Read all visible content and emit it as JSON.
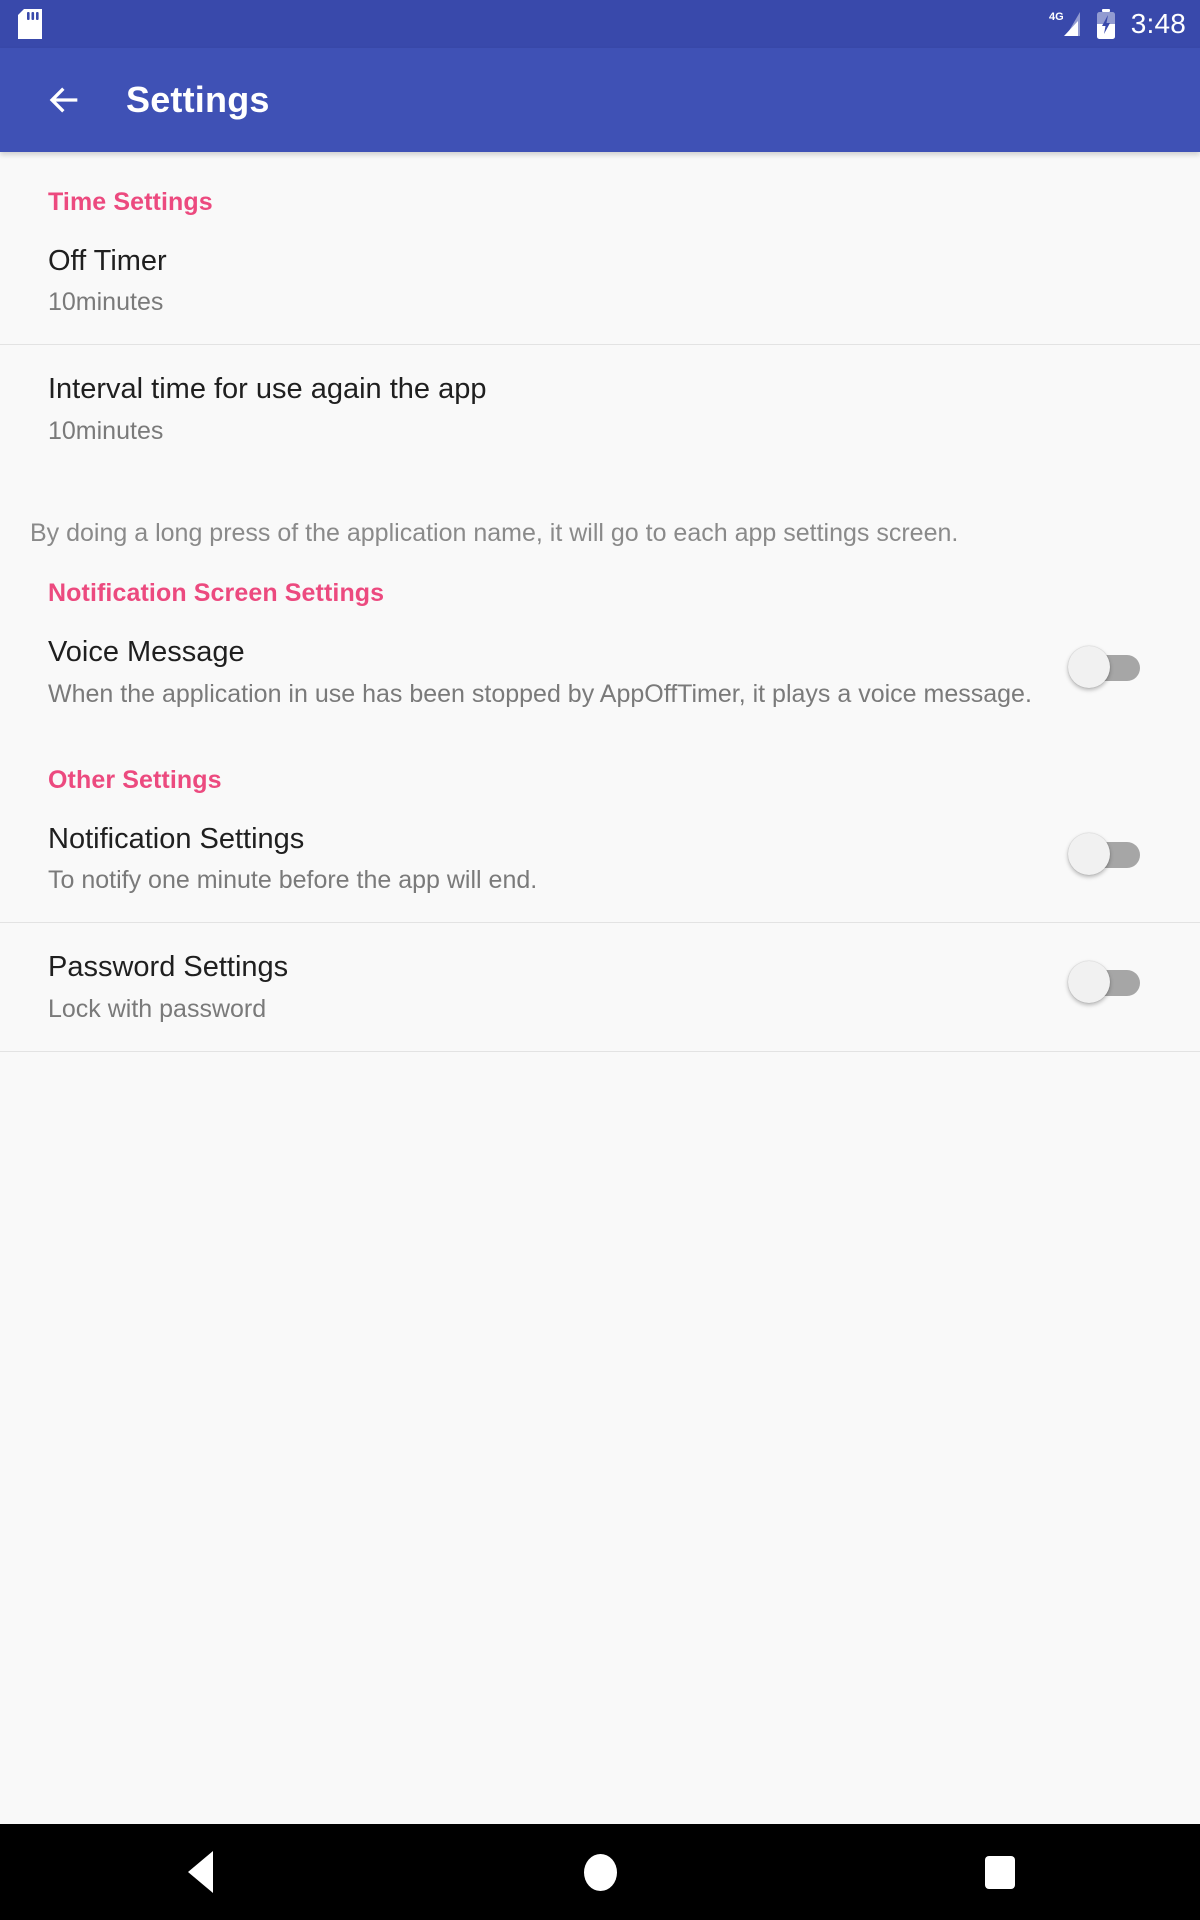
{
  "status_bar": {
    "sd_card_icon": "sd-card-icon",
    "network_label": "4G",
    "signal_icon": "signal-bars-icon",
    "battery_icon": "battery-charging-icon",
    "time": "3:48",
    "background_color": "#3949ab"
  },
  "app_bar": {
    "back_icon": "back-arrow-icon",
    "title": "Settings",
    "background_color": "#3f51b5"
  },
  "theme": {
    "accent_pink": "#ec4a7f",
    "primary_blue": "#3f51b5",
    "page_background": "#f9f9f9"
  },
  "sections": {
    "time_settings": {
      "header": "Time Settings",
      "rows": [
        {
          "title": "Off Timer",
          "summary": "10minutes"
        },
        {
          "title": "Interval time for use again the app",
          "summary": "10minutes"
        }
      ],
      "hint": "By doing a long press of the application name, it will go to each app settings screen."
    },
    "notification_screen_settings": {
      "header": "Notification Screen Settings",
      "rows": [
        {
          "title": "Voice Message",
          "summary": "When the application in use has been stopped by AppOffTimer, it plays a voice message.",
          "switch_state": "off"
        }
      ]
    },
    "other_settings": {
      "header": "Other Settings",
      "rows": [
        {
          "title": "Notification Settings",
          "summary": "To notify one minute before the app will end.",
          "switch_state": "off"
        },
        {
          "title": "Password Settings",
          "summary": "Lock with password",
          "switch_state": "off"
        }
      ]
    }
  },
  "nav_bar": {
    "back_icon": "nav-back-triangle-icon",
    "home_icon": "nav-home-circle-icon",
    "recents_icon": "nav-recents-square-icon"
  }
}
